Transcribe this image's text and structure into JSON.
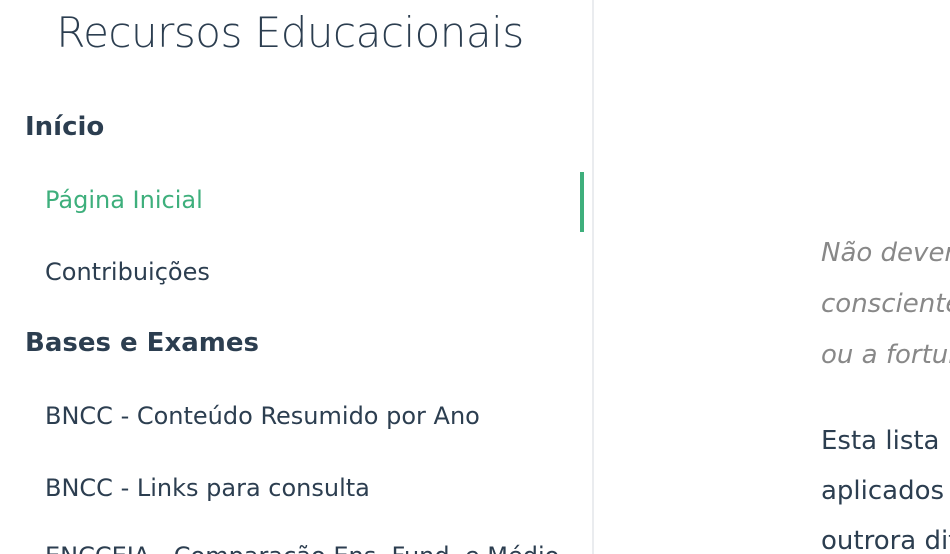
{
  "sidebar": {
    "title": "Recursos Educacionais",
    "groups": [
      {
        "label": "Início",
        "items": [
          {
            "label": "Página Inicial",
            "active": true
          },
          {
            "label": "Contribuições",
            "active": false
          }
        ]
      },
      {
        "label": "Bases e Exames",
        "items": [
          {
            "label": "BNCC - Conteúdo Resumido por Ano",
            "active": false
          },
          {
            "label": "BNCC - Links para consulta",
            "active": false
          },
          {
            "label": "ENCCEJA - Comparação Ens. Fund. e Médio",
            "active": false
          }
        ]
      }
    ],
    "accent_color": "#3eaf7c"
  },
  "main": {
    "quote_lines": [
      "Não dever",
      "consciente",
      "ou a fortun"
    ],
    "paragraph_lines": [
      "Esta lista p",
      "aplicados",
      "outrora dif"
    ]
  }
}
